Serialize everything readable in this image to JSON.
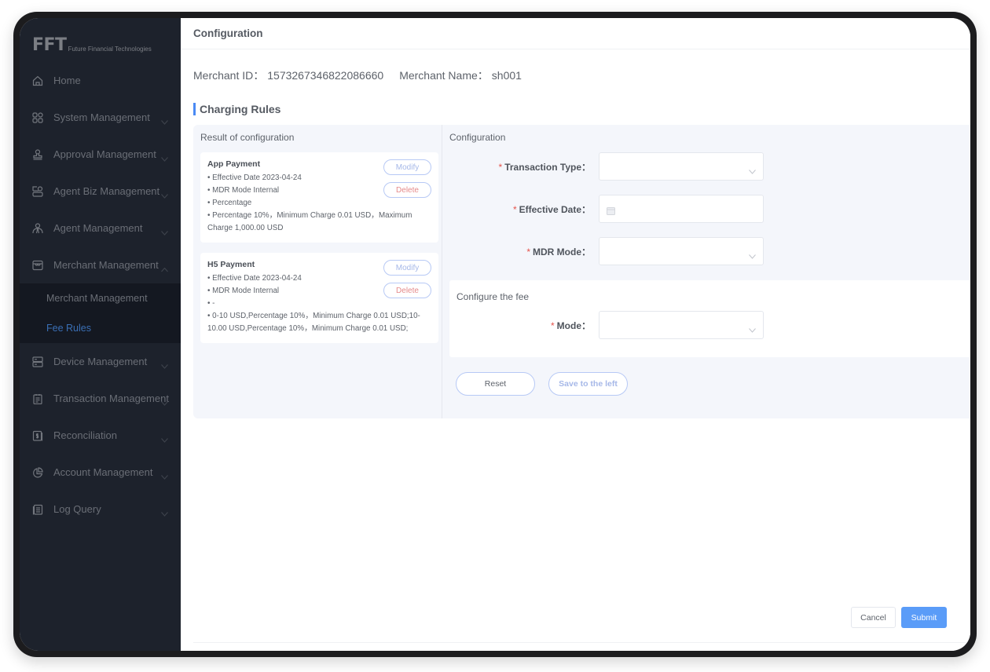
{
  "sidebar": {
    "logo": {
      "mark": "FFT",
      "text": "Future Financial Technologies"
    },
    "items": [
      {
        "label": "Home",
        "icon": "home-icon",
        "expandable": false
      },
      {
        "label": "System Management",
        "icon": "grid-icon",
        "expandable": true
      },
      {
        "label": "Approval Management",
        "icon": "stamp-icon",
        "expandable": true
      },
      {
        "label": "Agent Biz Management",
        "icon": "agent-card-icon",
        "expandable": true
      },
      {
        "label": "Agent Management",
        "icon": "person-icon",
        "expandable": true
      },
      {
        "label": "Merchant Management",
        "icon": "store-icon",
        "expandable": true,
        "expanded": true,
        "children": [
          {
            "label": "Merchant Management",
            "active": false
          },
          {
            "label": "Fee Rules",
            "active": true
          }
        ]
      },
      {
        "label": "Device Management",
        "icon": "server-icon",
        "expandable": true
      },
      {
        "label": "Transaction Management",
        "icon": "clipboard-icon",
        "expandable": true
      },
      {
        "label": "Reconciliation",
        "icon": "dollar-doc-icon",
        "expandable": true
      },
      {
        "label": "Account Management",
        "icon": "pie-chart-icon",
        "expandable": true
      },
      {
        "label": "Log Query",
        "icon": "log-doc-icon",
        "expandable": true
      }
    ]
  },
  "header": {
    "title": "Configuration"
  },
  "merchant": {
    "id_label": "Merchant ID：",
    "id_value": "1573267346822086660",
    "name_label": "Merchant Name：",
    "name_value": "sh001"
  },
  "charging_rules": {
    "title": "Charging Rules",
    "result_title": "Result of configuration",
    "rules": [
      {
        "name": "App Payment",
        "lines": [
          "• Effective Date 2023-04-24",
          "• MDR Mode Internal",
          "• Percentage",
          "• Percentage 10%，Minimum Charge 0.01 USD，Maximum Charge 1,000.00 USD"
        ],
        "modify_label": "Modify",
        "delete_label": "Delete"
      },
      {
        "name": "H5 Payment",
        "lines": [
          "• Effective Date 2023-04-24",
          "• MDR Mode Internal",
          "• -",
          "• 0-10 USD,Percentage 10%，Minimum Charge 0.01 USD;10-10.00 USD,Percentage 10%，Minimum Charge 0.01 USD;"
        ],
        "modify_label": "Modify",
        "delete_label": "Delete"
      }
    ],
    "config_title": "Configuration",
    "fields": {
      "transaction_type": {
        "label": "Transaction Type：",
        "value": "",
        "required": "*"
      },
      "effective_date": {
        "label": "Effective Date：",
        "value": "",
        "required": "*"
      },
      "mdr_mode": {
        "label": "MDR Mode：",
        "value": "",
        "required": "*"
      }
    },
    "fee": {
      "title": "Configure the fee",
      "mode": {
        "label": "Mode：",
        "value": "",
        "required": "*"
      }
    },
    "reset_label": "Reset",
    "save_label": "Save to the left"
  },
  "footer": {
    "cancel_label": "Cancel",
    "submit_label": "Submit"
  },
  "colors": {
    "accent": "#5a9cf8",
    "sidebar_bg": "#1d222c",
    "active_sub": "#3a6fb5",
    "danger": "#e58a8a"
  }
}
